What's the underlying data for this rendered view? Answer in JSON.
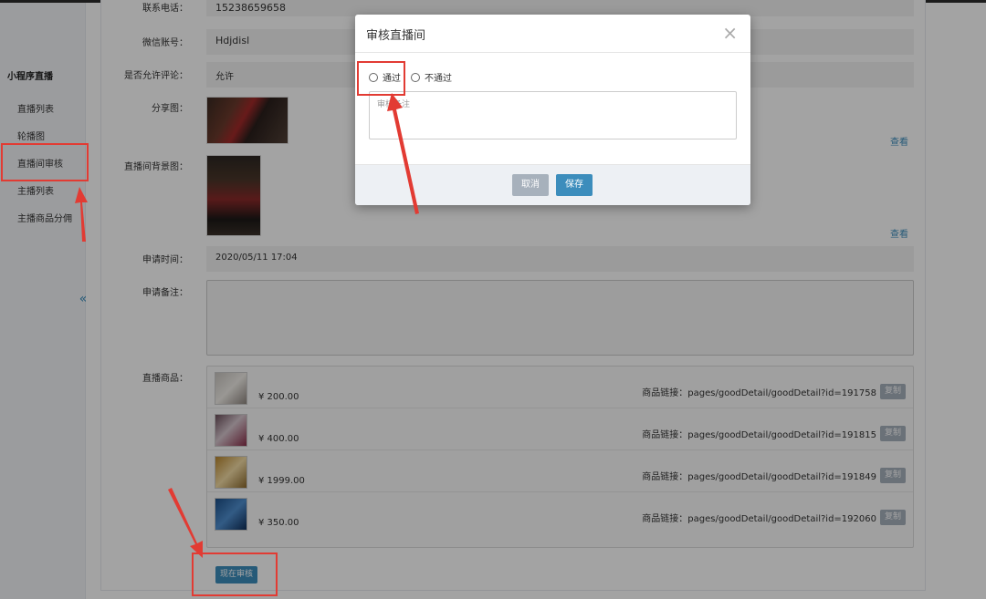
{
  "sidebar": {
    "title": "小程序直播",
    "items": [
      {
        "label": "直播列表"
      },
      {
        "label": "轮播图"
      },
      {
        "label": "直播间审核"
      },
      {
        "label": "主播列表"
      },
      {
        "label": "主播商品分佣"
      }
    ],
    "collapse_glyph": "«"
  },
  "form": {
    "phone_label": "联系电话：",
    "phone_value": "15238659658",
    "wechat_label": "微信账号：",
    "wechat_value": "Hdjdisl",
    "comment_label": "是否允许评论：",
    "comment_value": "允许",
    "share_label": "分享图：",
    "bg_label": "直播间背景图：",
    "view_link": "查看",
    "apply_time_label": "申请时间：",
    "apply_time_value": "2020/05/11 17:04",
    "remark_label": "申请备注：",
    "goods_label": "直播商品：",
    "goods": [
      {
        "price": "¥ 200.00",
        "link": "商品链接：pages/goodDetail/goodDetail?id=191758",
        "copy": "复制"
      },
      {
        "price": "¥ 400.00",
        "link": "商品链接：pages/goodDetail/goodDetail?id=191815",
        "copy": "复制"
      },
      {
        "price": "¥ 1999.00",
        "link": "商品链接：pages/goodDetail/goodDetail?id=191849",
        "copy": "复制"
      },
      {
        "price": "¥ 350.00",
        "link": "商品链接：pages/goodDetail/goodDetail?id=192060",
        "copy": "复制"
      }
    ],
    "review_button": "现在审核"
  },
  "modal": {
    "title": "审核直播间",
    "close_glyph": "×",
    "option_pass": "通过",
    "option_fail": "不通过",
    "remark_placeholder": "审核备注",
    "cancel": "取消",
    "save": "保存"
  },
  "colors": {
    "accent": "#3c8dbc",
    "annotation": "#e23b33",
    "disabled_button": "#a7b1bc"
  }
}
